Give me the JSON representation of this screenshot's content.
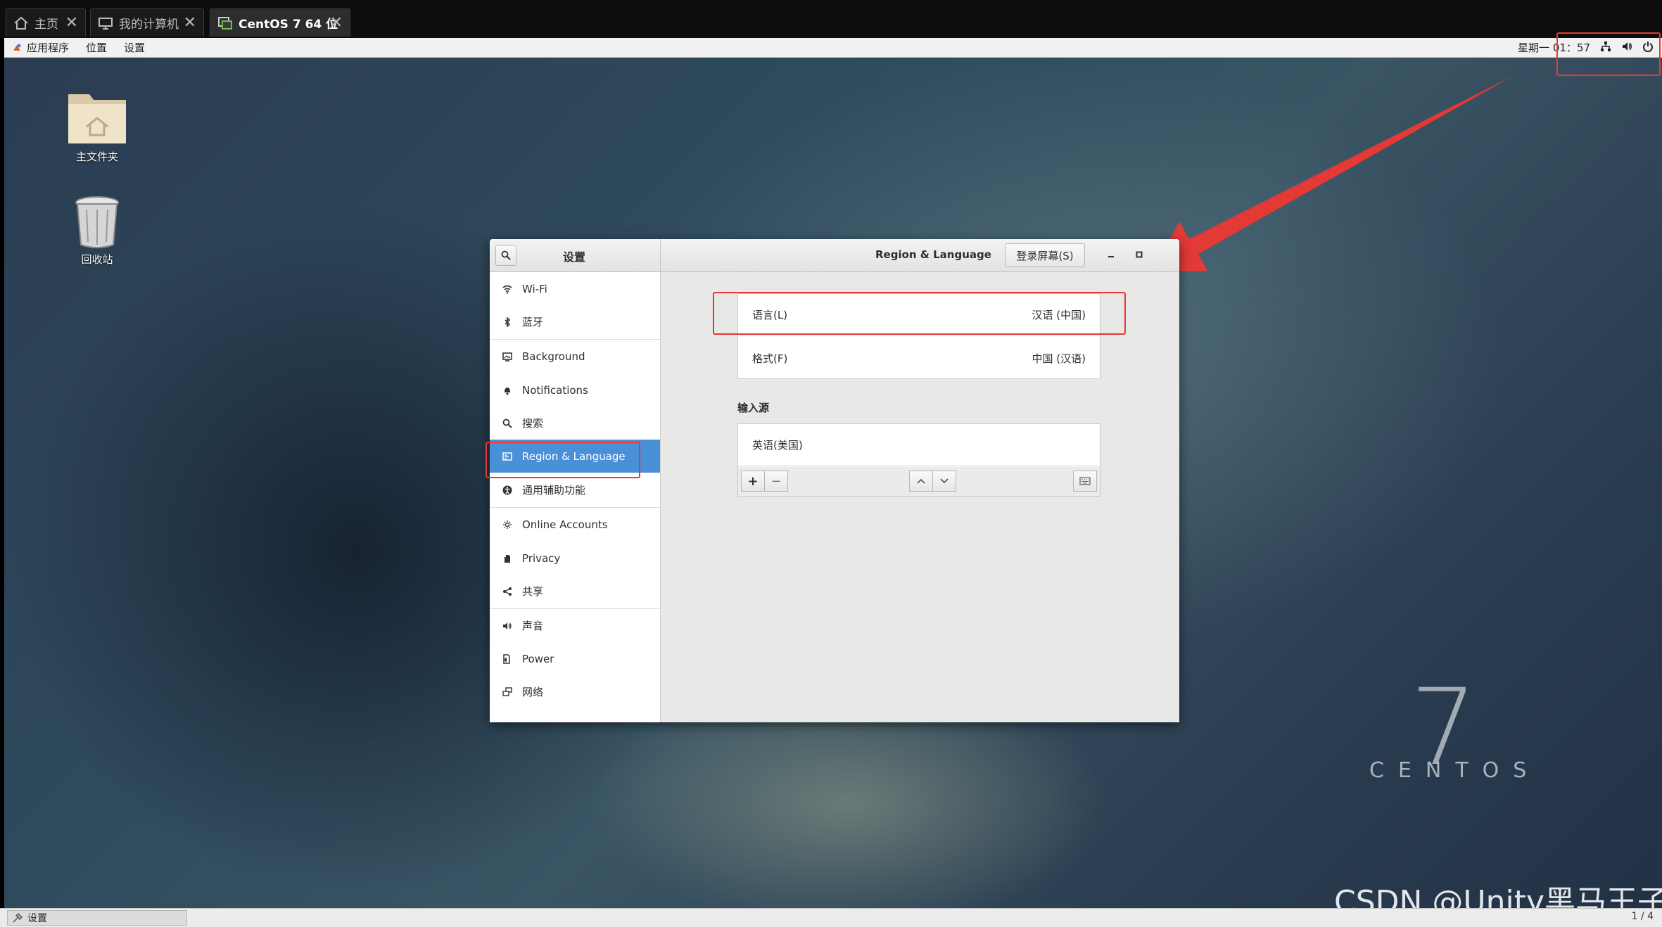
{
  "vm_tabs": [
    {
      "label": "主页",
      "icon": "home-icon"
    },
    {
      "label": "我的计算机",
      "icon": "monitor-icon"
    },
    {
      "label": "CentOS 7 64 位",
      "icon": "vm-icon"
    }
  ],
  "topbar": {
    "menu": [
      "应用程序",
      "位置",
      "设置"
    ],
    "clock": "星期一 01：57",
    "status_icons": [
      "network-icon",
      "volume-icon",
      "power-icon"
    ]
  },
  "desktop": {
    "icons": [
      {
        "label": "主文件夹",
        "icon": "home-folder-icon"
      },
      {
        "label": "回收站",
        "icon": "trash-icon"
      }
    ],
    "centos_logo": {
      "numeral": "7",
      "word": "CENTOS"
    },
    "watermark": "CSDN @Unity黑马王子"
  },
  "settings_window": {
    "sidebar_title": "设置",
    "panel_title": "Region & Language",
    "login_screen_button": "登录屏幕(S)",
    "sidebar_items": [
      {
        "label": "Wi-Fi",
        "icon": "wifi-icon"
      },
      {
        "label": "蓝牙",
        "icon": "bluetooth-icon"
      },
      {
        "label": "Background",
        "icon": "background-icon"
      },
      {
        "label": "Notifications",
        "icon": "bell-icon"
      },
      {
        "label": "搜索",
        "icon": "search-icon"
      },
      {
        "label": "Region & Language",
        "icon": "flag-icon",
        "selected": true
      },
      {
        "label": "通用辅助功能",
        "icon": "accessibility-icon"
      },
      {
        "label": "Online Accounts",
        "icon": "online-accounts-icon"
      },
      {
        "label": "Privacy",
        "icon": "privacy-hand-icon"
      },
      {
        "label": "共享",
        "icon": "share-icon"
      },
      {
        "label": "声音",
        "icon": "sound-icon"
      },
      {
        "label": "Power",
        "icon": "power-plug-icon"
      },
      {
        "label": "网络",
        "icon": "network-icon"
      }
    ],
    "language_row": {
      "label": "语言(L)",
      "value": "汉语 (中国)"
    },
    "formats_row": {
      "label": "格式(F)",
      "value": "中国 (汉语)"
    },
    "input_sources_heading": "输入源",
    "input_sources": [
      "英语(美国)"
    ],
    "toolbar": {
      "add": "+",
      "remove": "−"
    }
  },
  "bottombar": {
    "task_label": "设置",
    "page": "1 / 4"
  },
  "annotation_color": "#e53935"
}
